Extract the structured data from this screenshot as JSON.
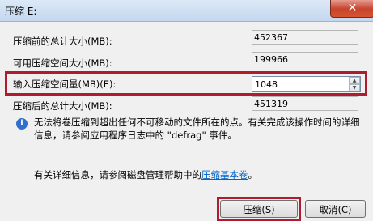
{
  "window": {
    "title": "压缩 E:",
    "close_glyph": "✕"
  },
  "fields": {
    "total_before_label": "压缩前的总计大小(MB):",
    "total_before_value": "452367",
    "available_label": "可用压缩空间大小(MB):",
    "available_value": "199966",
    "shrink_amount_label": "输入压缩空间量(MB)(E):",
    "shrink_amount_value": "1048",
    "total_after_label": "压缩后的总计大小(MB):",
    "total_after_value": "451319"
  },
  "info": {
    "icon": "info-icon",
    "text": "无法将卷压缩到超出任何不可移动的文件所在的点。有关完成该操作时间的详细信息，请参阅应用程序日志中的 \"defrag\" 事件。"
  },
  "help": {
    "prefix": "有关详细信息，请参阅磁盘管理帮助中的",
    "link": "压缩基本卷",
    "suffix": "。"
  },
  "buttons": {
    "shrink": "压缩(S)",
    "cancel": "取消(C)"
  },
  "colors": {
    "highlight": "#b01c2e",
    "link": "#0066cc"
  }
}
